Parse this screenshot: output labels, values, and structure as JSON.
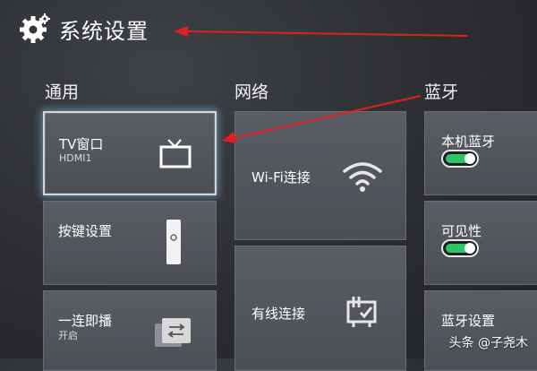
{
  "header": {
    "title": "系统设置",
    "icon": "gear-icon"
  },
  "sections": {
    "general": "通用",
    "network": "网络",
    "bluetooth": "蓝牙"
  },
  "tiles": {
    "tv_window": {
      "label": "TV窗口",
      "sub": "HDMI1",
      "icon": "tv-icon"
    },
    "key_settings": {
      "label": "按键设置",
      "icon": "remote-icon"
    },
    "one_touch_play": {
      "label": "一连即播",
      "sub": "开启",
      "icon": "switch-screen-icon"
    },
    "wifi": {
      "label": "Wi-Fi连接",
      "icon": "wifi-icon"
    },
    "wired": {
      "label": "有线连接",
      "icon": "ethernet-icon"
    },
    "local_bt": {
      "label": "本机蓝牙",
      "toggle": true
    },
    "visibility": {
      "label": "可见性",
      "toggle": true
    },
    "bt_settings": {
      "label": "蓝牙设置"
    }
  },
  "colors": {
    "toggle_on": "#2fc46a",
    "annotation_arrow": "#e02020",
    "selected_glow": "#8cbee6"
  },
  "watermark": "头条 @子尧木"
}
